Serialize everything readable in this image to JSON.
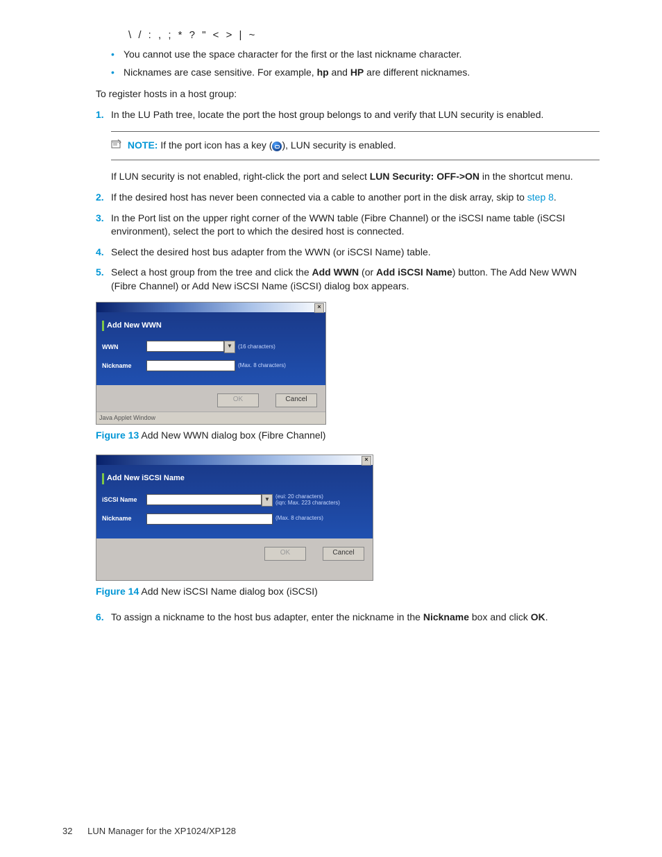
{
  "symbols_line": "\\ / : , ; * ? \" < > | ~",
  "bullets": [
    {
      "text": "You cannot use the space character for the first or the last nickname character."
    },
    {
      "pre": "Nicknames are case sensitive. For example, ",
      "b1": "hp",
      "mid": " and ",
      "b2": "HP",
      "post": " are different nicknames."
    }
  ],
  "intro": "To register hosts in a host group:",
  "steps": {
    "s1": {
      "num": "1.",
      "text": "In the LU Path tree, locate the port the host group belongs to and verify that LUN security is enabled."
    },
    "note": {
      "label": "NOTE:",
      "text": "If the port icon has a key (",
      "text2": "), LUN security is enabled."
    },
    "s1b": {
      "pre": "If LUN security is not enabled, right-click the port and select ",
      "b": "LUN Security: OFF->ON",
      "post": " in the shortcut menu."
    },
    "s2": {
      "num": "2.",
      "text": "If the desired host has never been connected via a cable to another port in the disk array, skip to ",
      "link": "step 8",
      "post": "."
    },
    "s3": {
      "num": "3.",
      "text": "In the Port list on the upper right corner of the WWN table (Fibre Channel) or the iSCSI name table (iSCSI environment), select the port to which the desired host is connected."
    },
    "s4": {
      "num": "4.",
      "text": "Select the desired host bus adapter from the WWN (or iSCSI Name) table."
    },
    "s5": {
      "num": "5.",
      "pre": "Select a host group from the tree and click the ",
      "b1": "Add WWN",
      "mid": " (or ",
      "b2": "Add iSCSI Name",
      "post": ") button. The Add New WWN (Fibre Channel) or Add New iSCSI Name (iSCSI) dialog box appears."
    },
    "s6": {
      "num": "6.",
      "pre": "To assign a nickname to the host bus adapter, enter the nickname in the ",
      "b1": "Nickname",
      "mid": " box and click ",
      "b2": "OK",
      "post": "."
    }
  },
  "figures": {
    "f13": {
      "label": "Figure 13",
      "caption": " Add New WWN dialog box (Fibre Channel)"
    },
    "f14": {
      "label": "Figure 14",
      "caption": " Add New iSCSI Name dialog box (iSCSI)"
    }
  },
  "dialog1": {
    "title": "Add New WWN",
    "row1_label": "WWN",
    "row1_hint": "(16 characters)",
    "row2_label": "Nickname",
    "row2_hint": "(Max. 8 characters)",
    "ok": "OK",
    "cancel": "Cancel",
    "status": "Java Applet Window"
  },
  "dialog2": {
    "title": "Add New iSCSI Name",
    "row1_label": "iSCSI Name",
    "row1_hint": "(eui: 20 characters)\n(iqn: Max. 223 characters)",
    "row2_label": "Nickname",
    "row2_hint": "(Max. 8 characters)",
    "ok": "OK",
    "cancel": "Cancel"
  },
  "footer": {
    "page": "32",
    "title": "LUN Manager for the XP1024/XP128"
  }
}
